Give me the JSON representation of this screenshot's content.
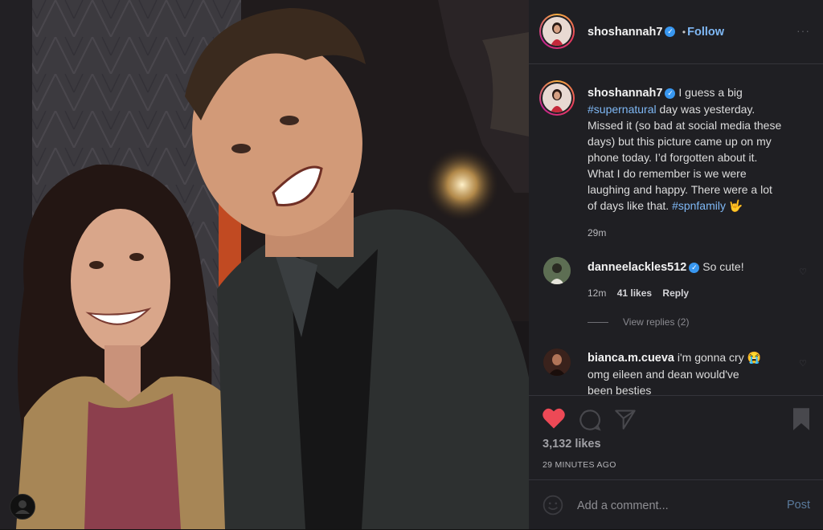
{
  "post": {
    "username": "shoshannah7",
    "follow_label": "Follow",
    "follow_separator": "•",
    "more_label": "···",
    "caption_lines": [
      {
        "pre": "I guess a big"
      },
      {
        "hash": "#supernatural",
        "post": " day was yesterday."
      },
      {
        "pre": "Missed it (so bad at social media these"
      },
      {
        "pre": "days) but this picture came up on my"
      },
      {
        "pre": "phone today. I’d forgotten about it."
      },
      {
        "pre": "What I do remember is we were"
      },
      {
        "pre": "laughing and happy. There were a lot"
      },
      {
        "pre": "of days like that. ",
        "hash": "#spnfamily",
        "post": " 🤟"
      }
    ],
    "caption_time": "29m"
  },
  "comments": [
    {
      "username": "danneelackles512",
      "text": "So cute!",
      "time": "12m",
      "likes": "41 likes",
      "reply": "Reply",
      "view_replies": "View replies (2)"
    },
    {
      "username": "bianca.m.cueva",
      "line1": "i'm gonna cry 😭",
      "line2": "omg eileen and dean would've",
      "line3": "been besties"
    }
  ],
  "actions": {
    "likes": "3,132 likes",
    "timestamp": "29 MINUTES AGO"
  },
  "add_comment": {
    "placeholder": "Add a comment...",
    "post_label": "Post"
  },
  "colors": {
    "link": "#7fb8f5",
    "verified": "#3897f0",
    "heart": "#ed4956",
    "panel_bg": "#1f1f23"
  }
}
